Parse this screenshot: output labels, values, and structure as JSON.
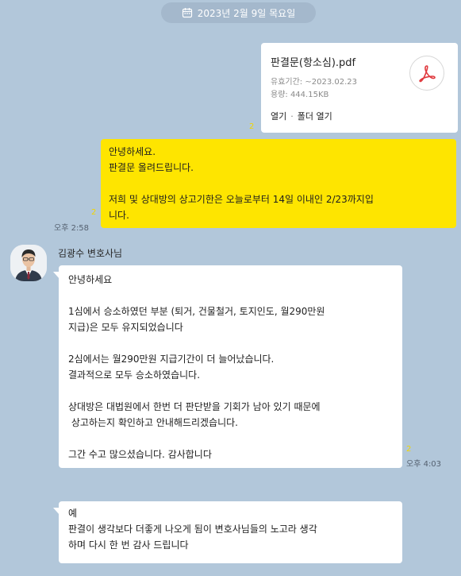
{
  "date_separator": {
    "text": "2023년 2월 9일 목요일",
    "icon": "calendar-icon"
  },
  "file_message": {
    "file_name": "판결문(항소심).pdf",
    "expiry": "유효기간: ~2023.02.23",
    "size": "용량: 444.15KB",
    "open_label": "열기",
    "separator": "·",
    "open_folder_label": "폴더 열기",
    "icon": "pdf-icon",
    "unread_count": "2"
  },
  "my_message": {
    "lines": [
      "안녕하세요.",
      "판결문 올려드립니다.",
      "",
      "저희 및 상대방의 상고기한은 오늘로부터 14일 이내인 2/23까지입",
      "니다."
    ],
    "unread_count": "2",
    "time": "오후 2:58"
  },
  "incoming": {
    "sender": "김광수 변호사님",
    "avatar_icon": "lawyer-avatar",
    "message1": {
      "lines": [
        "안녕하세요",
        "",
        "1심에서 승소하였던 부분 (퇴거, 건물철거, 토지인도, 월290만원",
        "지급)은 모두 유지되었습니다",
        "",
        "2심에서는 월290만원 지급기간이 더 늘어났습니다.",
        "결과적으로 모두 승소하였습니다.",
        "",
        "상대방은 대법원에서 한번 더 판단받을 기회가 남아 있기 때문에",
        " 상고하는지 확인하고 안내해드리겠습니다.",
        "",
        "그간 수고 많으셨습니다. 감사합니다"
      ],
      "unread_count": "2",
      "time": "오후 4:03"
    },
    "message2": {
      "lines": [
        "예",
        "판결이 생각보다 더좋게 나오게 됨이 변호사님들의 노고라 생각",
        "하며 다시 한 번 감사 드립니다"
      ]
    }
  },
  "colors": {
    "background": "#b2c7da",
    "my_bubble": "#fee500",
    "other_bubble": "#ffffff",
    "unread": "#f2d600",
    "pdf_accent": "#e0393e"
  }
}
